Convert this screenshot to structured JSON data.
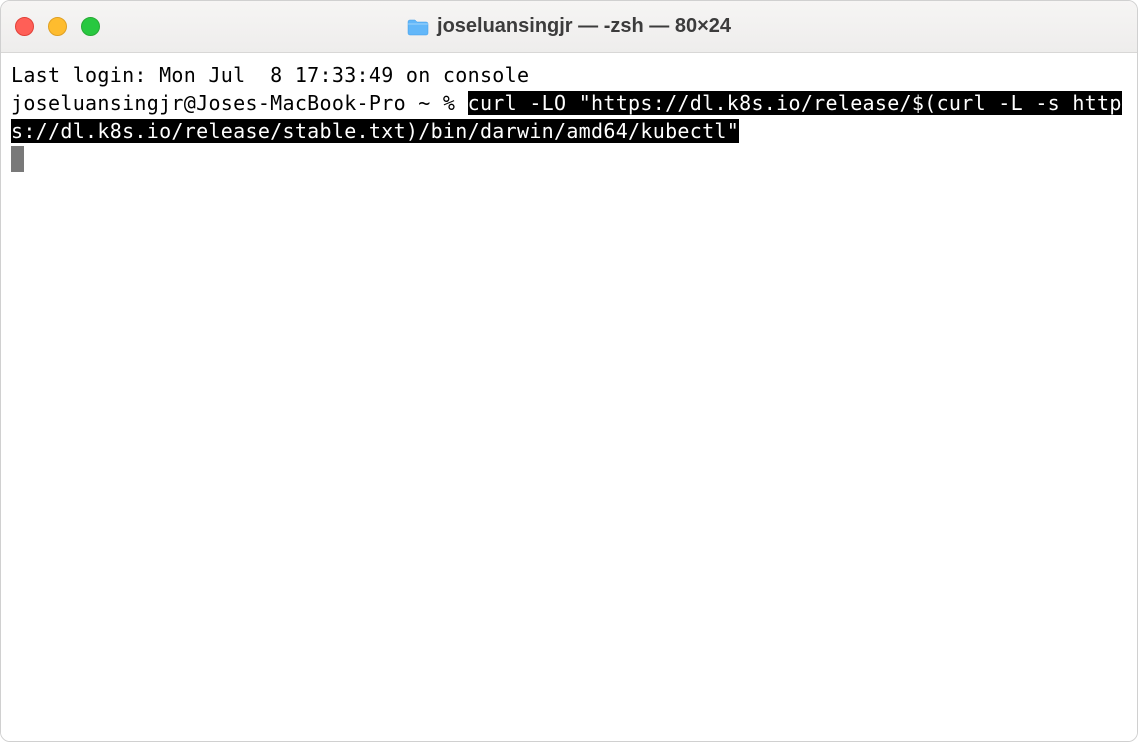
{
  "window": {
    "title": "joseluansingjr — -zsh — 80×24"
  },
  "terminal": {
    "lastLogin": "Last login: Mon Jul  8 17:33:49 on console",
    "prompt": "joseluansingjr@Joses-MacBook-Pro ~ % ",
    "commandLine1": "curl -LO \"https://dl.k8s.io/release/$(curl ",
    "commandLine2": "-L -s https://dl.k8s.io/release/stable.txt)/bin/darwin/amd64/kubectl\""
  },
  "colors": {
    "close": "#ff5f57",
    "minimize": "#febc2e",
    "maximize": "#28c840",
    "selectionBg": "#000000",
    "selectionFg": "#ffffff"
  }
}
